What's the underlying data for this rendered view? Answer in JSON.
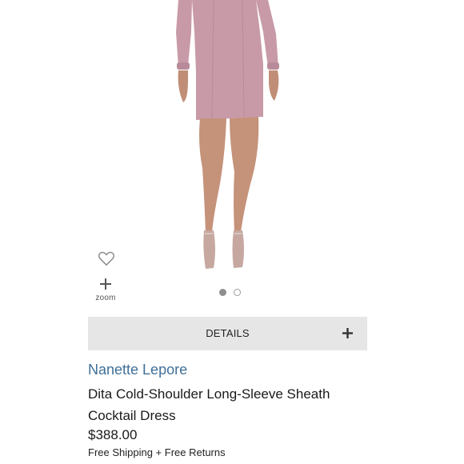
{
  "product": {
    "image_alt": "Dita Cold-Shoulder Long-Sleeve Sheath Cocktail Dress",
    "dress_color": "#c89aa8",
    "brand": "Nanette Lepore",
    "title_line1": "Dita Cold-Shoulder Long-Sleeve Sheath",
    "title_line2": "Cocktail Dress",
    "price": "$388.00",
    "shipping": "Free Shipping + Free Returns"
  },
  "gallery": {
    "zoom_label": "zoom",
    "wishlist_icon": "heart-outline-icon",
    "zoom_icon": "plus-icon",
    "dots_total": 2,
    "active_index": 0
  },
  "details": {
    "label": "DETAILS",
    "expand_icon": "plus-icon"
  },
  "colors": {
    "brand_link": "#3f6f98",
    "details_bg": "#e6e6e6"
  }
}
